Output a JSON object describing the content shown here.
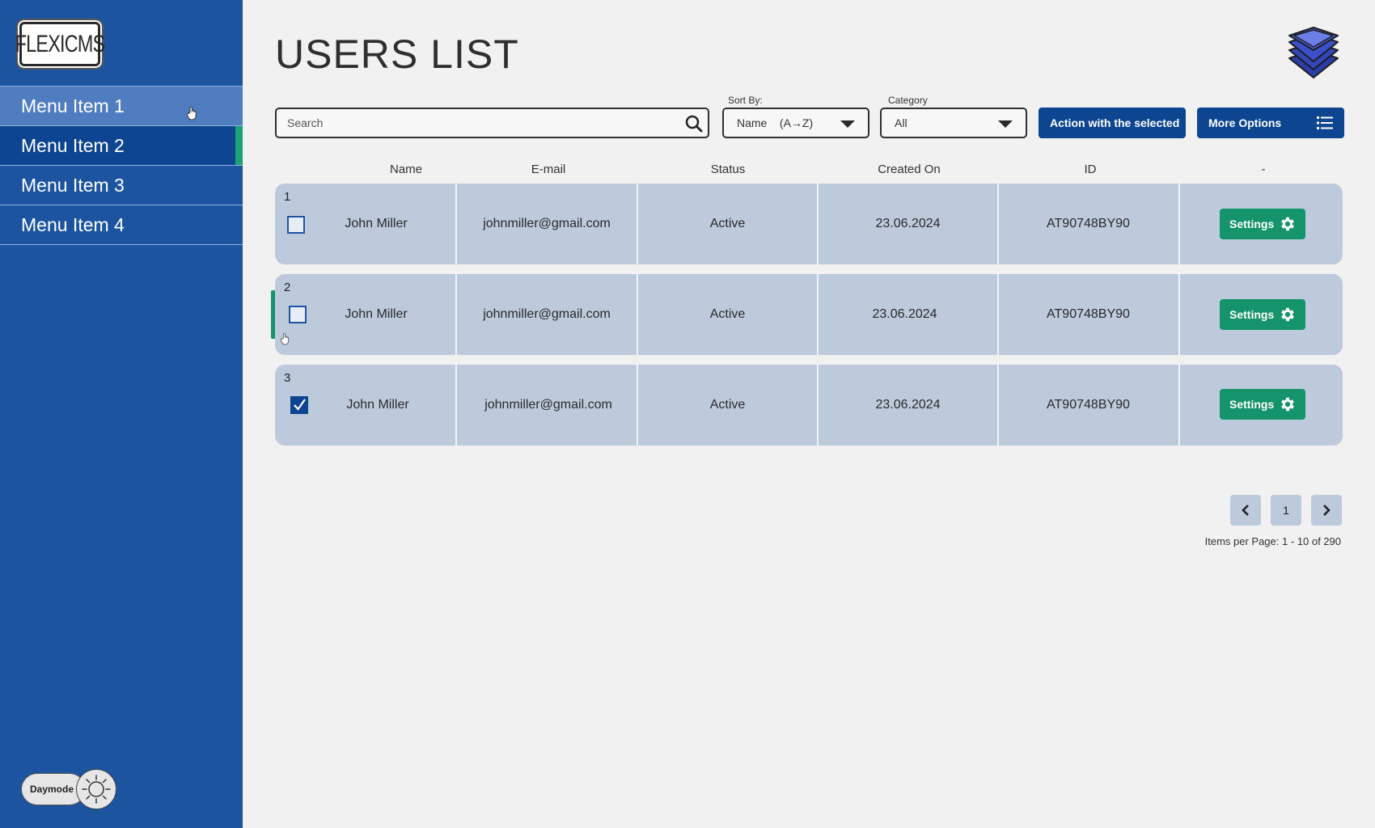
{
  "logo": {
    "text": "FLEXICMS"
  },
  "sidebar": {
    "items": [
      {
        "label": "Menu Item 1",
        "state": "hover"
      },
      {
        "label": "Menu Item 2",
        "state": "active"
      },
      {
        "label": "Menu Item 3",
        "state": "normal"
      },
      {
        "label": "Menu Item 4",
        "state": "normal"
      }
    ],
    "daymode_label": "Daymode"
  },
  "header": {
    "title": "USERS LIST"
  },
  "toolbar": {
    "search_placeholder": "Search",
    "sort_label": "Sort By:",
    "sort_value": "Name    (A→Z)",
    "category_label": "Category",
    "category_value": "All",
    "action_label": "Action with the selected",
    "more_label": "More Options"
  },
  "table": {
    "columns": [
      "Name",
      "E-mail",
      "Status",
      "Created On",
      "ID",
      "-"
    ],
    "rows": [
      {
        "num": "1",
        "checked": false,
        "name": "John Miller",
        "email": "johnmiller@gmail.com",
        "status": "Active",
        "created": "23.06.2024",
        "id": "AT90748BY90",
        "action": "Settings"
      },
      {
        "num": "2",
        "checked": false,
        "name": "John Miller",
        "email": "johnmiller@gmail.com",
        "status": "Active",
        "created": "23.06.2024",
        "id": "AT90748BY90",
        "action": "Settings"
      },
      {
        "num": "3",
        "checked": true,
        "name": "John Miller",
        "email": "johnmiller@gmail.com",
        "status": "Active",
        "created": "23.06.2024",
        "id": "AT90748BY90",
        "action": "Settings"
      }
    ]
  },
  "pagination": {
    "current_page": "1",
    "items_per_page": "Items per Page: 1 - 10 of 290"
  },
  "colors": {
    "sidebar": "#1c54a0",
    "primary": "#0d4590",
    "accent_green": "#15946b",
    "row_bg": "#bccadc"
  },
  "icons": [
    "search-icon",
    "chevron-down-icon",
    "list-icon",
    "gear-icon",
    "chevron-left-icon",
    "chevron-right-icon",
    "sun-icon",
    "stack-layers-icon",
    "hand-cursor-icon",
    "checkmark-icon"
  ]
}
